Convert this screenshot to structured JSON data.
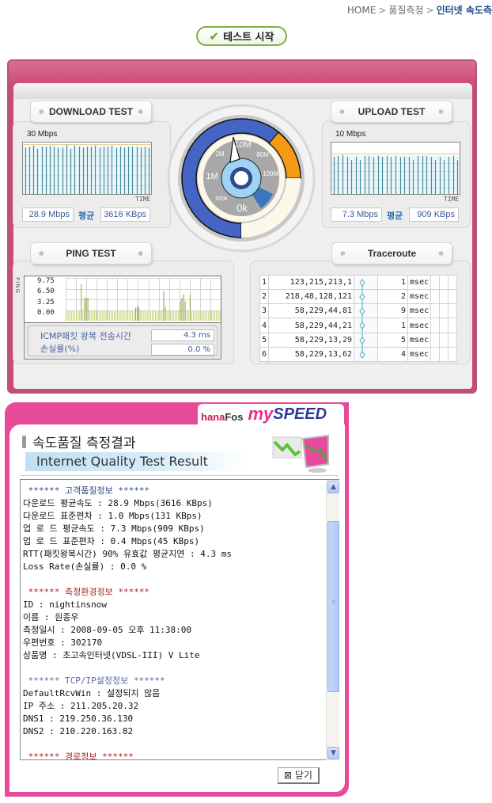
{
  "breadcrumb": {
    "items": [
      "HOME",
      "품질측정",
      "인터넷 속도측"
    ],
    "separator": ">"
  },
  "start_button": {
    "label": "테스트 시작",
    "icon": "checkmark-icon"
  },
  "download": {
    "title": "DOWNLOAD TEST",
    "scale_label": "30 Mbps",
    "time_label": "TIME",
    "speed": "28.9 Mbps",
    "avg_label": "평균",
    "kbps": "3616 KBps",
    "bar_fractions": [
      0.9,
      0.92,
      0.94,
      0.88,
      0.92,
      0.92,
      0.94,
      0.92,
      0.9,
      0.9,
      0.96,
      0.88,
      0.94,
      0.92,
      0.9,
      0.92,
      0.92,
      0.94,
      0.9,
      0.92,
      0.92,
      0.94,
      0.9,
      0.92,
      0.9,
      0.92,
      0.92,
      0.92,
      0.9,
      0.92,
      0.9
    ],
    "avg_fraction": 0.96
  },
  "upload": {
    "title": "UPLOAD TEST",
    "scale_label": "10 Mbps",
    "time_label": "TIME",
    "speed": "7.3 Mbps",
    "avg_label": "평균",
    "kbps": "909 KBps",
    "bar_fractions": [
      0.72,
      0.74,
      0.76,
      0.72,
      0.66,
      0.72,
      0.66,
      0.74,
      0.74,
      0.72,
      0.74,
      0.72,
      0.74,
      0.72,
      0.74,
      0.72,
      0.72,
      0.72,
      0.66,
      0.74,
      0.74,
      0.74,
      0.72,
      0.66,
      0.72,
      0.66,
      0.72,
      0.74,
      0.66
    ],
    "avg_fraction": 0.78
  },
  "gauge": {
    "labels": [
      "0k",
      "500k",
      "1M",
      "2M",
      "10M",
      "60M",
      "100M"
    ],
    "needle_label": "current speed needle"
  },
  "ping": {
    "title": "PING TEST",
    "axis_label": "PING",
    "y_ticks": [
      "9.75",
      "6.50",
      "3.25",
      "0.00"
    ],
    "y_max": 13,
    "values": [
      3,
      3,
      3,
      3,
      3,
      3,
      3,
      3,
      3,
      11,
      3,
      7,
      7,
      7,
      3,
      3,
      3,
      3,
      3,
      3,
      3,
      3,
      3,
      3,
      3,
      3,
      3,
      3,
      3,
      3,
      3,
      3,
      3,
      3,
      3,
      3,
      3,
      3,
      3,
      3,
      3,
      3,
      4,
      4.5,
      4,
      3,
      3,
      3,
      3,
      3,
      3,
      3,
      3,
      3,
      3,
      3,
      3,
      3,
      3,
      9,
      4,
      3,
      3,
      3,
      3,
      3,
      3,
      3,
      3,
      6,
      7,
      8,
      6,
      3,
      3,
      8,
      3,
      3,
      3,
      3,
      3,
      3,
      3,
      3,
      3,
      3,
      3,
      3,
      3,
      3,
      3,
      3,
      3,
      3
    ],
    "rtt_label": "ICMP패킷 왕복 전송시간",
    "rtt_value": "4.3 ms",
    "loss_label": "손실률(%)",
    "loss_value": "0.0 %"
  },
  "traceroute": {
    "title": "Traceroute",
    "hops": [
      {
        "hop": "1",
        "ip": "123,215,213,1",
        "ms": "1",
        "unit": "msec"
      },
      {
        "hop": "2",
        "ip": "218,48,128,121",
        "ms": "2",
        "unit": "msec"
      },
      {
        "hop": "3",
        "ip": "58,229,44,81",
        "ms": "9",
        "unit": "msec"
      },
      {
        "hop": "4",
        "ip": "58,229,44,21",
        "ms": "1",
        "unit": "msec"
      },
      {
        "hop": "5",
        "ip": "58,229,13,29",
        "ms": "5",
        "unit": "msec"
      },
      {
        "hop": "6",
        "ip": "58,229,13,62",
        "ms": "4",
        "unit": "msec"
      }
    ]
  },
  "result": {
    "brand_hana": "hana",
    "brand_fos": "Fos",
    "brand_my": "my",
    "brand_speed": "SPEED",
    "title": "속도품질 측정결과",
    "subtitle": "Internet Quality Test Result",
    "lines": [
      {
        "text": " ****** 고객품질정보 ******",
        "style": "hdr-blue"
      },
      {
        "text": "다운로드 평균속도 : 28.9 Mbps(3616 KBps)",
        "style": ""
      },
      {
        "text": "다운로드 표준편차 : 1.0 Mbps(131 KBps)",
        "style": ""
      },
      {
        "text": "업 로 드 평균속도 : 7.3 Mbps(909 KBps)",
        "style": ""
      },
      {
        "text": "업 로 드 표준편차 : 0.4 Mbps(45 KBps)",
        "style": ""
      },
      {
        "text": "RTT(패킷왕복시간) 90% 유효값 평균지연 : 4.3 ms",
        "style": ""
      },
      {
        "text": "Loss Rate(손실률) : 0.0 %",
        "style": ""
      },
      {
        "text": "",
        "style": "blank"
      },
      {
        "text": " ****** 측정환경정보 ******",
        "style": "hdr-red"
      },
      {
        "text": "ID : nightinsnow",
        "style": ""
      },
      {
        "text": "이름 : 원종우",
        "style": ""
      },
      {
        "text": "측정일시 : 2008-09-05 오후 11:38:00",
        "style": ""
      },
      {
        "text": "우편번호 : 302170",
        "style": ""
      },
      {
        "text": "상품명 : 초고속인터넷(VDSL-III) V Lite",
        "style": ""
      },
      {
        "text": "",
        "style": "blank"
      },
      {
        "text": " ****** TCP/IP설정정보 ******",
        "style": "hdr-gray"
      },
      {
        "text": "DefaultRcvWin : 설정되지 않음",
        "style": ""
      },
      {
        "text": "IP 주소 : 211.205.20.32",
        "style": ""
      },
      {
        "text": "DNS1 : 219.250.36.130",
        "style": ""
      },
      {
        "text": "DNS2 : 210.220.163.82",
        "style": ""
      },
      {
        "text": "",
        "style": "blank"
      },
      {
        "text": " ****** 경로정보 ******",
        "style": "hdr-red"
      }
    ],
    "close_label": "⊠ 닫기"
  }
}
